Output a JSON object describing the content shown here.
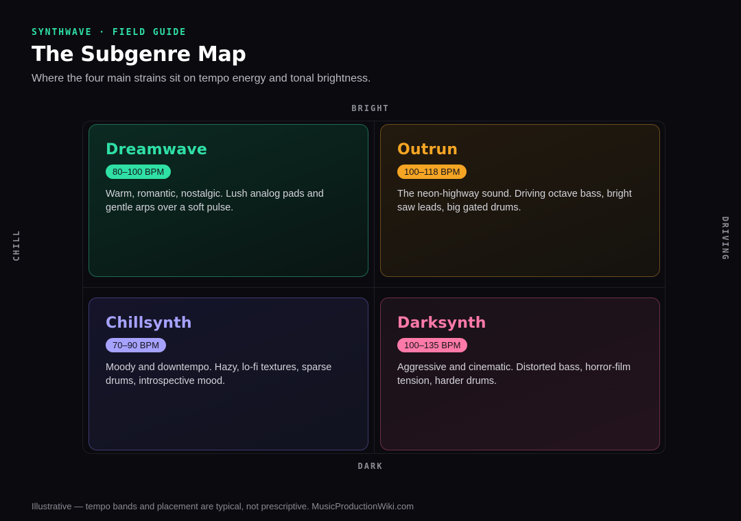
{
  "header": {
    "kicker": "SYNTHWAVE · FIELD GUIDE",
    "title": "The Subgenre Map",
    "subtitle": "Where the four main strains sit on tempo energy and tonal brightness."
  },
  "axes": {
    "top": "BRIGHT",
    "bottom": "DARK",
    "left": "CHILL",
    "right": "DRIVING"
  },
  "quadrants": [
    {
      "id": "dreamwave",
      "name": "Dreamwave",
      "bpm": "80–100 BPM",
      "description": "Warm, romantic, nostalgic. Lush analog pads and gentle arps over a soft pulse.",
      "accent": "#2fe0a4",
      "bg_from": "#0b2a22",
      "bg_to": "#0a1513",
      "border": "#1f6b54"
    },
    {
      "id": "outrun",
      "name": "Outrun",
      "bpm": "100–118 BPM",
      "description": "The neon-highway sound. Driving octave bass, bright saw leads, big gated drums.",
      "accent": "#f5a524",
      "bg_from": "#231a0e",
      "bg_to": "#15120e",
      "border": "#6a4c1c"
    },
    {
      "id": "chillsynth",
      "name": "Chillsynth",
      "bpm": "70–90 BPM",
      "description": "Moody and downtempo. Hazy, lo-fi textures, sparse drums, introspective mood.",
      "accent": "#a6a2ff",
      "bg_from": "#15142a",
      "bg_to": "#12131f",
      "border": "#3e3c72"
    },
    {
      "id": "darksynth",
      "name": "Darksynth",
      "bpm": "100–135 BPM",
      "description": "Aggressive and cinematic. Distorted bass, horror-film tension, harder drums.",
      "accent": "#ff7aa8",
      "bg_from": "#1a1219",
      "bg_to": "#23131c",
      "border": "#6b2f47"
    }
  ],
  "footer": "Illustrative — tempo bands and placement are typical, not prescriptive. MusicProductionWiki.com"
}
